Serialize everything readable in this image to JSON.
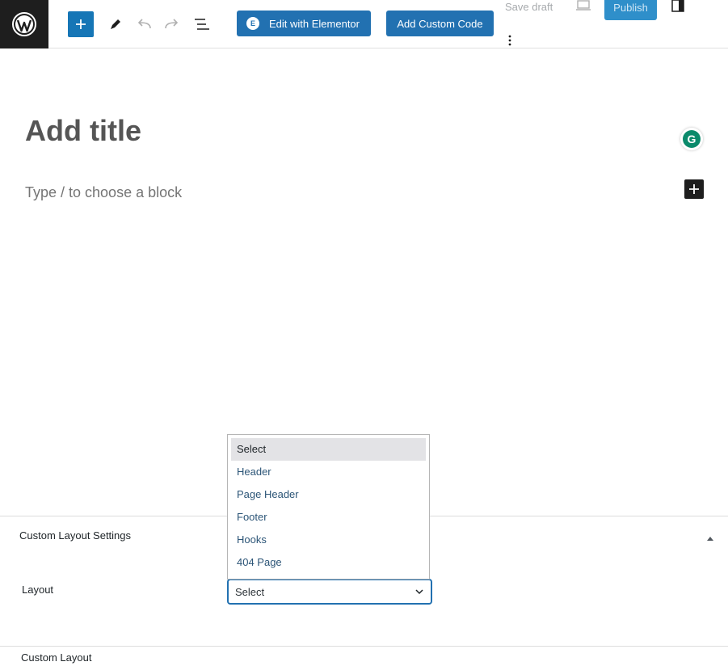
{
  "toolbar": {
    "elementor_label": "Edit with Elementor",
    "elementor_badge": "E",
    "custom_code_label": "Add Custom Code",
    "save_draft_label": "Save draft",
    "publish_label": "Publish"
  },
  "editor": {
    "title_placeholder": "Add title",
    "block_placeholder": "Type / to choose a block",
    "grammarly_letter": "G"
  },
  "meta_box": {
    "title": "Custom Layout Settings",
    "layout_label": "Layout",
    "layout_value": "Select",
    "options": [
      "Select",
      "Header",
      "Page Header",
      "Footer",
      "Hooks",
      "404 Page"
    ]
  },
  "footer": {
    "label": "Custom Layout"
  },
  "colors": {
    "accent": "#2271b1",
    "dark": "#1e1e1e"
  }
}
